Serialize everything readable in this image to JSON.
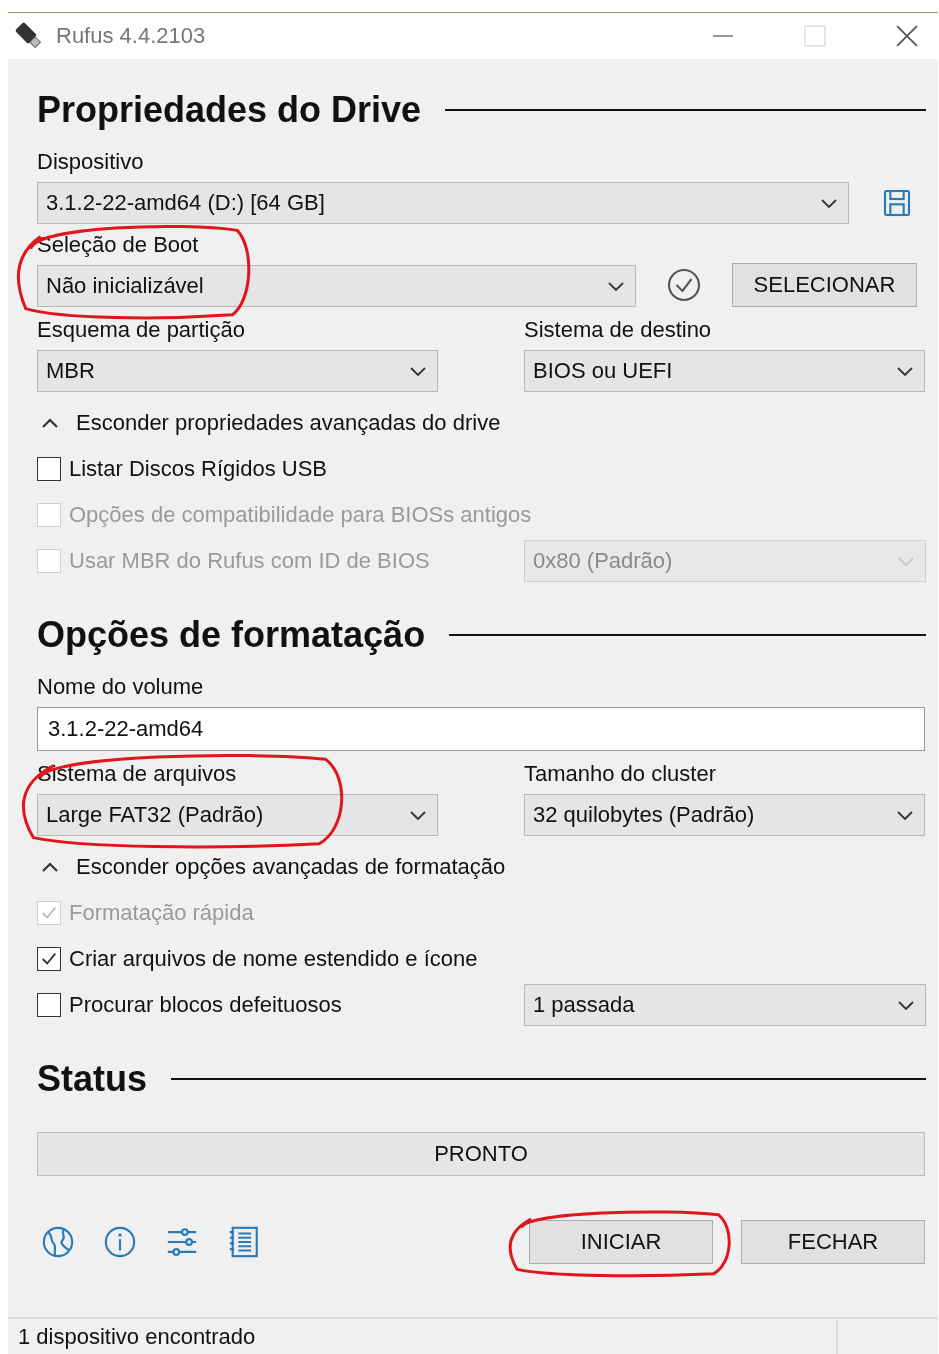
{
  "window": {
    "title": "Rufus 4.4.2103"
  },
  "drive_properties": {
    "heading": "Propriedades do Drive",
    "device": {
      "label": "Dispositivo",
      "value": "3.1.2-22-amd64 (D:) [64 GB]",
      "highlighted": false
    },
    "boot_selection": {
      "label": "Seleção de Boot",
      "value": "Não inicializável",
      "highlighted": true
    },
    "select_button": "SELECIONAR",
    "partition_scheme": {
      "label": "Esquema de partição",
      "value": "MBR",
      "highlighted": false
    },
    "target_system": {
      "label": "Sistema de destino",
      "value": "BIOS ou UEFI",
      "highlighted": false
    },
    "advanced_toggle": {
      "label": "Esconder propriedades avançadas do drive",
      "expanded": true
    },
    "options": [
      {
        "label": "Listar Discos Rígidos USB",
        "checked": false,
        "disabled": false
      },
      {
        "label": "Opções de compatibilidade para BIOSs antigos",
        "checked": false,
        "disabled": true
      },
      {
        "label": "Usar MBR do Rufus com ID de BIOS",
        "checked": false,
        "disabled": true,
        "dropdown": {
          "value": "0x80 (Padrão)",
          "disabled": true
        }
      }
    ]
  },
  "format_options": {
    "heading": "Opções de formatação",
    "volume_label": {
      "label": "Nome do volume",
      "value": "3.1.2-22-amd64"
    },
    "file_system": {
      "label": "Sistema de arquivos",
      "value": "Large FAT32 (Padrão)",
      "highlighted": true
    },
    "cluster_size": {
      "label": "Tamanho do cluster",
      "value": "32 quilobytes (Padrão)",
      "highlighted": false
    },
    "advanced_toggle": {
      "label": "Esconder opções avançadas de formatação",
      "expanded": true
    },
    "options": [
      {
        "label": "Formatação rápida",
        "checked": true,
        "disabled": true
      },
      {
        "label": "Criar arquivos de nome estendido e ícone",
        "checked": true,
        "disabled": false
      },
      {
        "label": "Procurar blocos defeituosos",
        "checked": false,
        "disabled": false,
        "dropdown": {
          "value": "1 passada",
          "disabled": false
        }
      }
    ]
  },
  "status": {
    "heading": "Status",
    "text": "PRONTO"
  },
  "buttons": [
    {
      "label": "INICIAR",
      "highlighted": true
    },
    {
      "label": "FECHAR",
      "highlighted": false
    }
  ],
  "status_bar": {
    "text": "1 dispositivo encontrado"
  }
}
